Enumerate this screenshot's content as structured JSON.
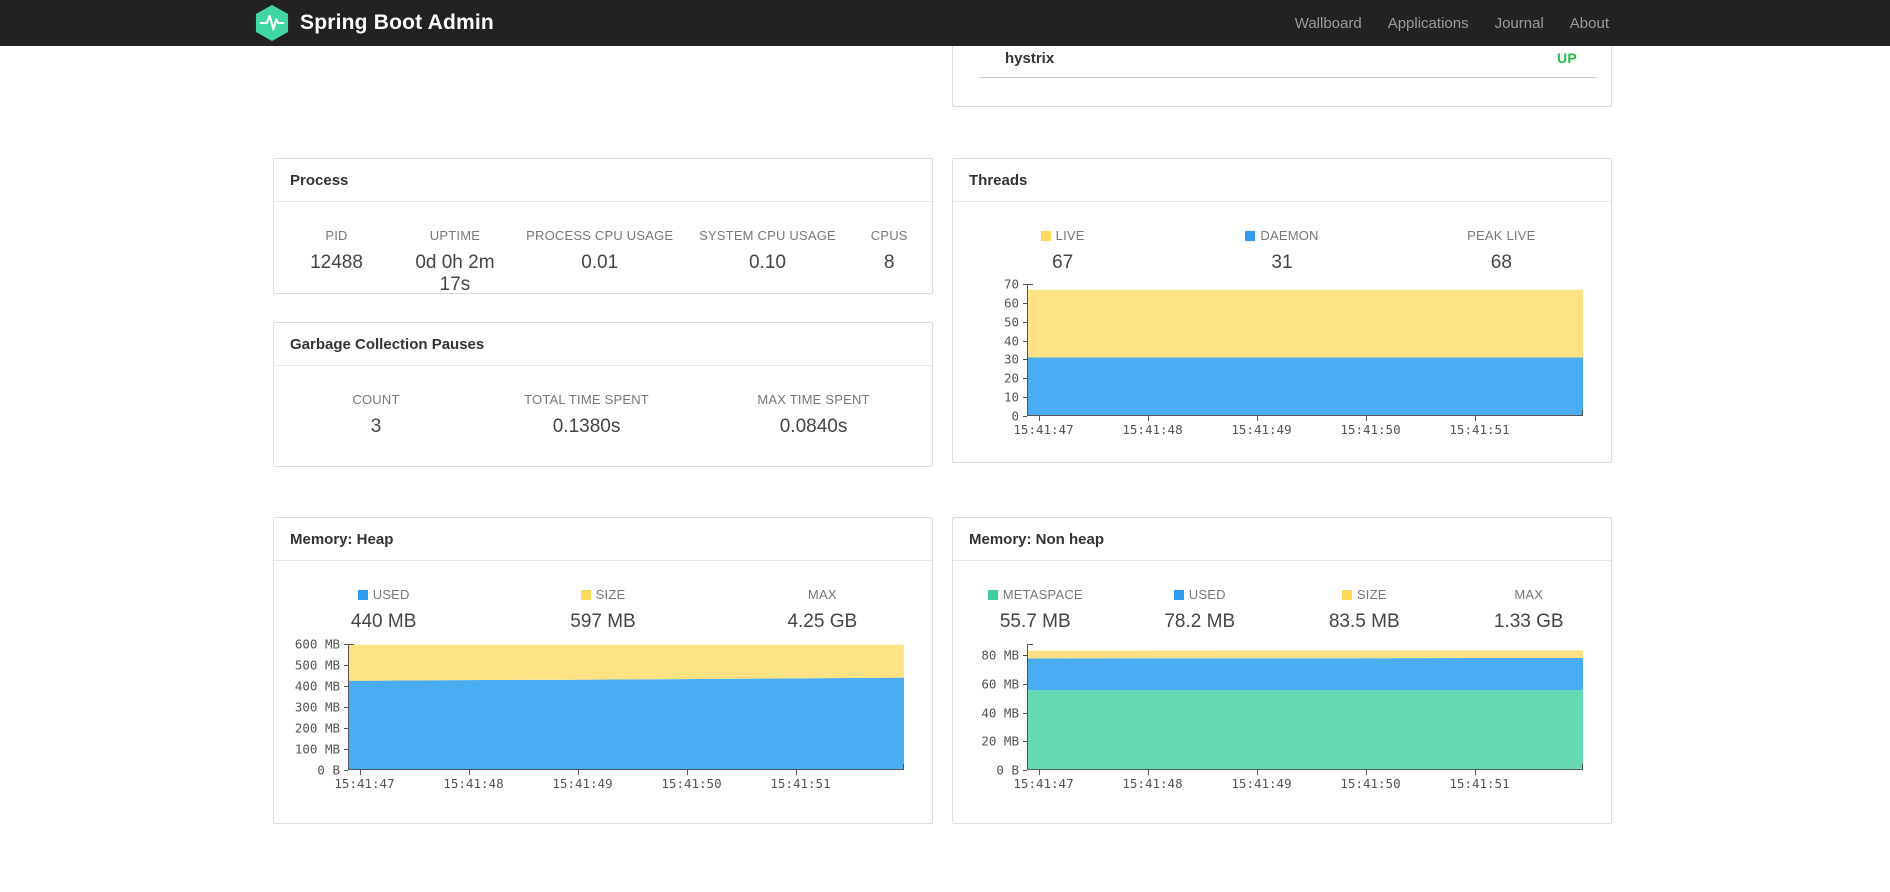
{
  "navbar": {
    "brand": "Spring Boot Admin",
    "items": [
      {
        "label": "Wallboard"
      },
      {
        "label": "Applications"
      },
      {
        "label": "Journal"
      },
      {
        "label": "About"
      }
    ],
    "background": "#222222",
    "brand_color": "#ffffff",
    "link_color": "#9a9a9a",
    "logo_color": "#3fd6a2"
  },
  "applications_card": {
    "rows": [
      {
        "name": "hystrix",
        "status": "UP",
        "status_color": "#21bf47"
      }
    ]
  },
  "process_card": {
    "title": "Process",
    "metrics": [
      {
        "label": "PID",
        "value": "12488"
      },
      {
        "label": "UPTIME",
        "value": "0d 0h 2m 17s"
      },
      {
        "label": "PROCESS CPU USAGE",
        "value": "0.01"
      },
      {
        "label": "SYSTEM CPU USAGE",
        "value": "0.10"
      },
      {
        "label": "CPUS",
        "value": "8"
      }
    ]
  },
  "gc_card": {
    "title": "Garbage Collection Pauses",
    "metrics": [
      {
        "label": "COUNT",
        "value": "3"
      },
      {
        "label": "TOTAL TIME SPENT",
        "value": "0.1380s"
      },
      {
        "label": "MAX TIME SPENT",
        "value": "0.0840s"
      }
    ]
  },
  "threads_card": {
    "title": "Threads",
    "metrics": [
      {
        "label": "LIVE",
        "value": "67",
        "swatch": "#ffd95c"
      },
      {
        "label": "DAEMON",
        "value": "31",
        "swatch": "#2e9bf0"
      },
      {
        "label": "PEAK LIVE",
        "value": "68",
        "swatch": ""
      }
    ]
  },
  "heap_card": {
    "title": "Memory: Heap",
    "metrics": [
      {
        "label": "USED",
        "value": "440 MB",
        "swatch": "#2e9bf0"
      },
      {
        "label": "SIZE",
        "value": "597 MB",
        "swatch": "#ffd95c"
      },
      {
        "label": "MAX",
        "value": "4.25 GB",
        "swatch": ""
      }
    ]
  },
  "nonheap_card": {
    "title": "Memory: Non heap",
    "metrics": [
      {
        "label": "METASPACE",
        "value": "55.7 MB",
        "swatch": "#41cf9e"
      },
      {
        "label": "USED",
        "value": "78.2 MB",
        "swatch": "#2e9bf0"
      },
      {
        "label": "SIZE",
        "value": "83.5 MB",
        "swatch": "#ffd95c"
      },
      {
        "label": "MAX",
        "value": "1.33 GB",
        "swatch": ""
      }
    ]
  },
  "chart_data": [
    {
      "id": "threads",
      "type": "area",
      "title": "Threads",
      "stacked": true,
      "values_are_stack_tops": true,
      "x_tick_labels": [
        "15:41:47",
        "15:41:48",
        "15:41:49",
        "15:41:50",
        "15:41:51"
      ],
      "x_tick_fractions": [
        0.022,
        0.218,
        0.414,
        0.61,
        0.806
      ],
      "ylim": [
        0,
        70
      ],
      "y_ticks": [
        {
          "v": 0,
          "label": "0"
        },
        {
          "v": 10,
          "label": "10"
        },
        {
          "v": 20,
          "label": "20"
        },
        {
          "v": 30,
          "label": "30"
        },
        {
          "v": 40,
          "label": "40"
        },
        {
          "v": 50,
          "label": "50"
        },
        {
          "v": 60,
          "label": "60"
        },
        {
          "v": 70,
          "label": "70"
        }
      ],
      "series": [
        {
          "name": "daemon",
          "fill": "#4aadf2",
          "stack_top_values": [
            31,
            31,
            31,
            31,
            31,
            31
          ]
        },
        {
          "name": "live",
          "fill": "#ffe283",
          "stack_top_values": [
            67,
            67,
            67,
            67,
            67,
            67
          ]
        }
      ],
      "grid": false,
      "legend_position": "above"
    },
    {
      "id": "heap",
      "type": "area",
      "title": "Memory: Heap",
      "stacked": true,
      "values_are_stack_tops": true,
      "x_tick_labels": [
        "15:41:47",
        "15:41:48",
        "15:41:49",
        "15:41:50",
        "15:41:51"
      ],
      "x_tick_fractions": [
        0.022,
        0.218,
        0.414,
        0.61,
        0.806
      ],
      "ylim": [
        0,
        600
      ],
      "y_ticks": [
        {
          "v": 0,
          "label": "0 B"
        },
        {
          "v": 100,
          "label": "100 MB"
        },
        {
          "v": 200,
          "label": "200 MB"
        },
        {
          "v": 300,
          "label": "300 MB"
        },
        {
          "v": 400,
          "label": "400 MB"
        },
        {
          "v": 500,
          "label": "500 MB"
        },
        {
          "v": 600,
          "label": "600 MB"
        }
      ],
      "series": [
        {
          "name": "used",
          "fill": "#4aadf2",
          "stack_top_values": [
            425,
            428,
            430,
            433,
            436,
            440
          ]
        },
        {
          "name": "size",
          "fill": "#ffe283",
          "stack_top_values": [
            597,
            597,
            597,
            597,
            597,
            597
          ]
        }
      ],
      "grid": false,
      "legend_position": "above"
    },
    {
      "id": "nonheap",
      "type": "area",
      "title": "Memory: Non heap",
      "stacked": true,
      "values_are_stack_tops": true,
      "x_tick_labels": [
        "15:41:47",
        "15:41:48",
        "15:41:49",
        "15:41:50",
        "15:41:51"
      ],
      "x_tick_fractions": [
        0.022,
        0.218,
        0.414,
        0.61,
        0.806
      ],
      "ylim": [
        0,
        88
      ],
      "y_ticks": [
        {
          "v": 0,
          "label": "0 B"
        },
        {
          "v": 20,
          "label": "20 MB"
        },
        {
          "v": 40,
          "label": "40 MB"
        },
        {
          "v": 60,
          "label": "60 MB"
        },
        {
          "v": 80,
          "label": "80 MB"
        }
      ],
      "series": [
        {
          "name": "metaspace",
          "fill": "#66d9b0",
          "stack_top_values": [
            55.7,
            55.7,
            55.7,
            55.7,
            55.7,
            55.7
          ]
        },
        {
          "name": "used",
          "fill": "#4aadf2",
          "stack_top_values": [
            77.9,
            78,
            78,
            78.1,
            78.2,
            78.2
          ]
        },
        {
          "name": "size",
          "fill": "#ffe283",
          "stack_top_values": [
            83.3,
            83.3,
            83.5,
            83.5,
            83.5,
            83.5
          ]
        }
      ],
      "grid": false,
      "legend_position": "above"
    }
  ]
}
